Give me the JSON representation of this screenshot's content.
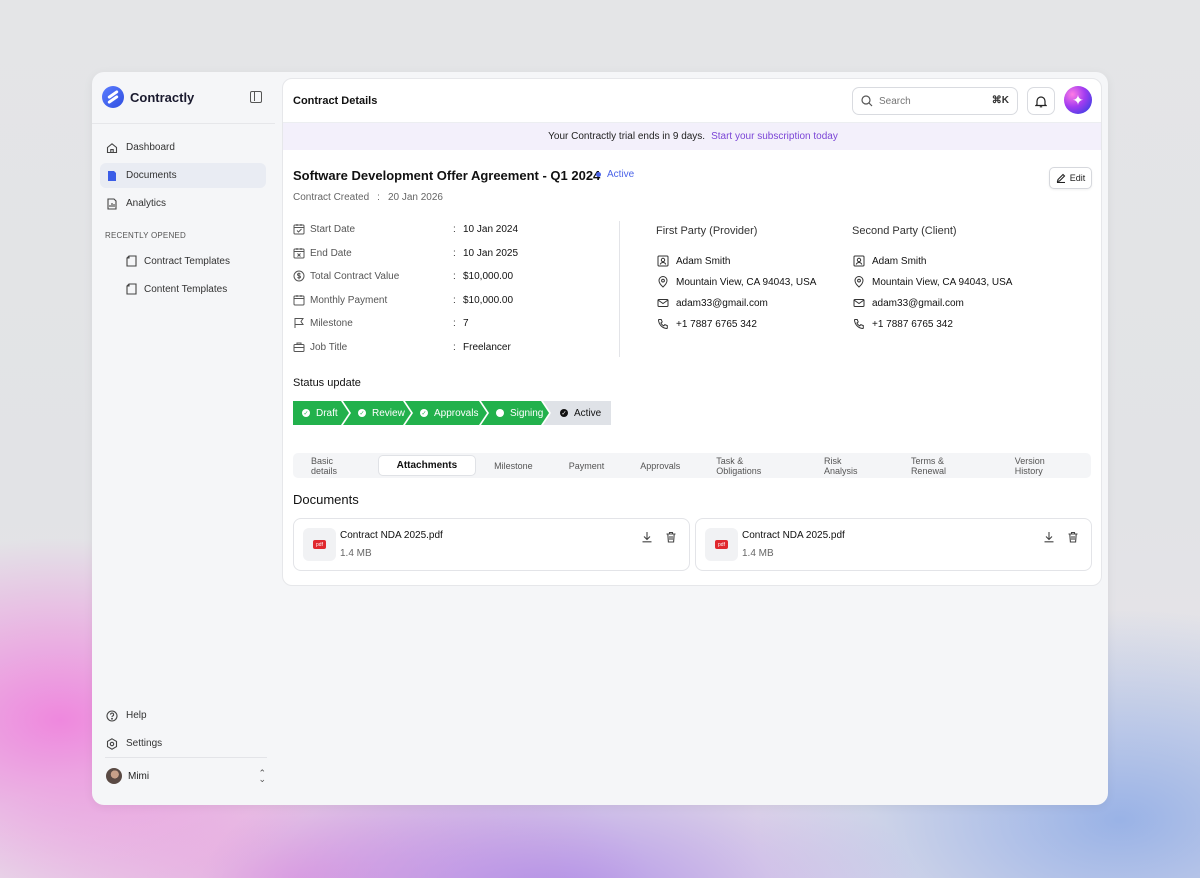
{
  "app": {
    "name": "Contractly"
  },
  "sidebar": {
    "items": [
      {
        "label": "Dashboard"
      },
      {
        "label": "Documents"
      },
      {
        "label": "Analytics"
      }
    ],
    "recent_label": "RECENTLY OPENED",
    "recent": [
      {
        "label": "Contract Templates"
      },
      {
        "label": "Content Templates"
      }
    ],
    "help": "Help",
    "settings": "Settings",
    "user": "Mimi"
  },
  "header": {
    "title": "Contract Details",
    "search_placeholder": "Search",
    "shortcut": "⌘K"
  },
  "trial": {
    "message": "Your Contractly trial ends in 9 days.",
    "link": "Start your subscription today"
  },
  "contract": {
    "title": "Software Development Offer Agreement - Q1 2024",
    "status": "Active",
    "edit": "Edit",
    "created_label": "Contract Created",
    "created_sep": ":",
    "created_value": "20 Jan 2026",
    "details": [
      {
        "label": "Start Date",
        "value": "10 Jan 2024"
      },
      {
        "label": "End Date",
        "value": "10 Jan 2025"
      },
      {
        "label": "Total Contract Value",
        "value": "$10,000.00"
      },
      {
        "label": "Monthly Payment",
        "value": "$10,000.00"
      },
      {
        "label": "Milestone",
        "value": "7"
      },
      {
        "label": "Job Title",
        "value": "Freelancer"
      }
    ],
    "first_party": {
      "title": "First Party (Provider)",
      "name": "Adam Smith",
      "address": "Mountain View, CA 94043, USA",
      "email": "adam33@gmail.com",
      "phone": "+1 7887 6765 342"
    },
    "second_party": {
      "title": "Second Party (Client)",
      "name": "Adam Smith",
      "address": "Mountain View, CA 94043, USA",
      "email": "adam33@gmail.com",
      "phone": "+1 7887 6765 342"
    }
  },
  "status_update": {
    "label": "Status update",
    "steps": [
      {
        "label": "Draft"
      },
      {
        "label": "Review"
      },
      {
        "label": "Approvals"
      },
      {
        "label": "Signing"
      },
      {
        "label": "Active"
      }
    ]
  },
  "tabs": [
    {
      "label": "Basic details"
    },
    {
      "label": "Attachments"
    },
    {
      "label": "Milestone"
    },
    {
      "label": "Payment"
    },
    {
      "label": "Approvals"
    },
    {
      "label": "Task & Obligations"
    },
    {
      "label": "Risk Analysis"
    },
    {
      "label": "Terms & Renewal"
    },
    {
      "label": "Version History"
    }
  ],
  "documents": {
    "title": "Documents",
    "files": [
      {
        "name": "Contract NDA 2025.pdf",
        "size": "1.4 MB",
        "badge": "pdf"
      },
      {
        "name": "Contract NDA 2025.pdf",
        "size": "1.4 MB",
        "badge": "pdf"
      }
    ]
  },
  "colors": {
    "accent": "#4a63e8",
    "success": "#22b14c",
    "trial_link": "#7b45d6"
  }
}
